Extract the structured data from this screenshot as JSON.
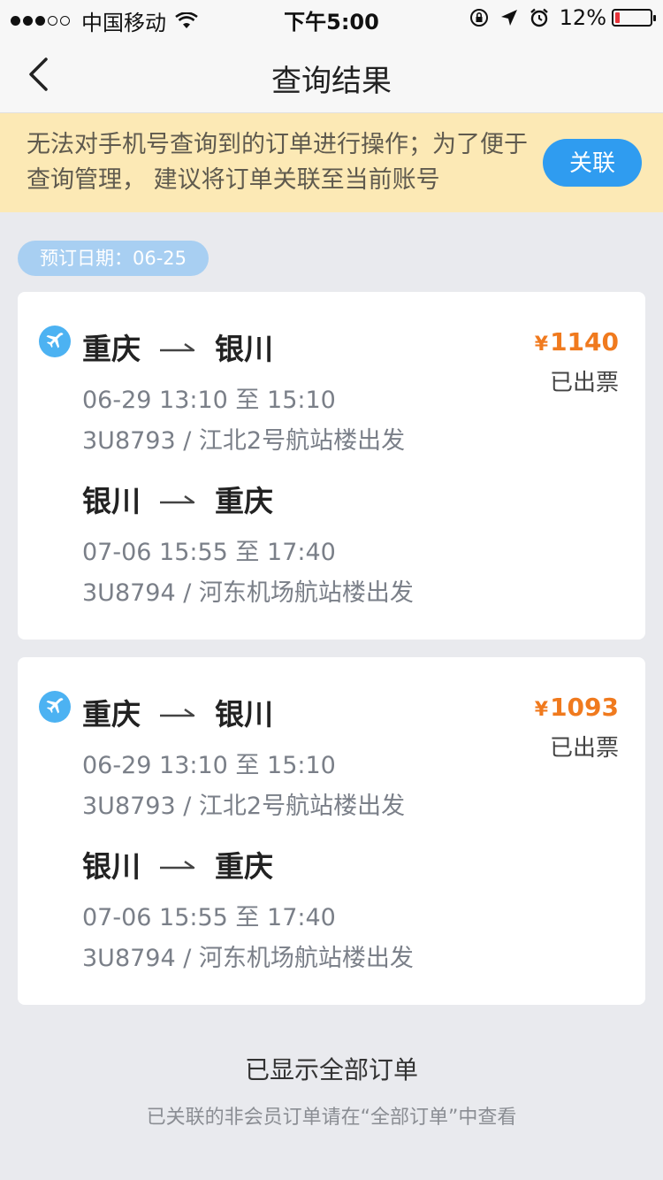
{
  "status_bar": {
    "carrier": "中国移动",
    "time": "下午5:00",
    "battery_pct": "12%",
    "battery_level": 0.12,
    "signal_bars": 3
  },
  "nav": {
    "title": "查询结果",
    "back_icon": "chevron-left-icon"
  },
  "notice": {
    "text": "无法对手机号查询到的订单进行操作；为了便于查询管理， 建议将订单关联至当前账号",
    "button_label": "关联",
    "bg_color": "#fce9b5",
    "button_color": "#2f9cf0"
  },
  "date_pill": "预订日期：06-25",
  "orders": [
    {
      "price": "1140",
      "currency": "¥",
      "status": "已出票",
      "legs": [
        {
          "from": "重庆",
          "to": "银川",
          "time": "06-29 13:10 至 15:10",
          "flight": "3U8793 / 江北2号航站楼出发"
        },
        {
          "from": "银川",
          "to": "重庆",
          "time": "07-06 15:55 至 17:40",
          "flight": "3U8794 / 河东机场航站楼出发"
        }
      ]
    },
    {
      "price": "1093",
      "currency": "¥",
      "status": "已出票",
      "legs": [
        {
          "from": "重庆",
          "to": "银川",
          "time": "06-29 13:10 至 15:10",
          "flight": "3U8793 / 江北2号航站楼出发"
        },
        {
          "from": "银川",
          "to": "重庆",
          "time": "07-06 15:55 至 17:40",
          "flight": "3U8794 / 河东机场航站楼出发"
        }
      ]
    }
  ],
  "footer": {
    "title": "已显示全部订单",
    "subtitle": "已关联的非会员订单请在“全部订单”中查看"
  },
  "colors": {
    "accent": "#2f9cf0",
    "price": "#f07a1e",
    "plane_icon": "#4cb2f2"
  }
}
